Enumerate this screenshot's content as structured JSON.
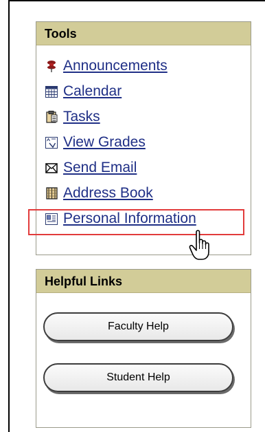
{
  "tools": {
    "title": "Tools",
    "items": [
      {
        "label": "Announcements",
        "icon": "pushpin-icon"
      },
      {
        "label": "Calendar",
        "icon": "calendar-icon"
      },
      {
        "label": "Tasks",
        "icon": "clipboard-icon"
      },
      {
        "label": "View Grades",
        "icon": "grades-icon"
      },
      {
        "label": "Send Email",
        "icon": "envelope-icon"
      },
      {
        "label": "Address Book",
        "icon": "address-book-icon"
      },
      {
        "label": "Personal Information",
        "icon": "personal-info-icon"
      }
    ]
  },
  "helpful_links": {
    "title": "Helpful Links",
    "buttons": [
      {
        "label": "Faculty Help"
      },
      {
        "label": "Student Help"
      }
    ]
  },
  "colors": {
    "header_bg": "#d2cc98",
    "link": "#1f2f86",
    "highlight": "#e23b3b"
  }
}
